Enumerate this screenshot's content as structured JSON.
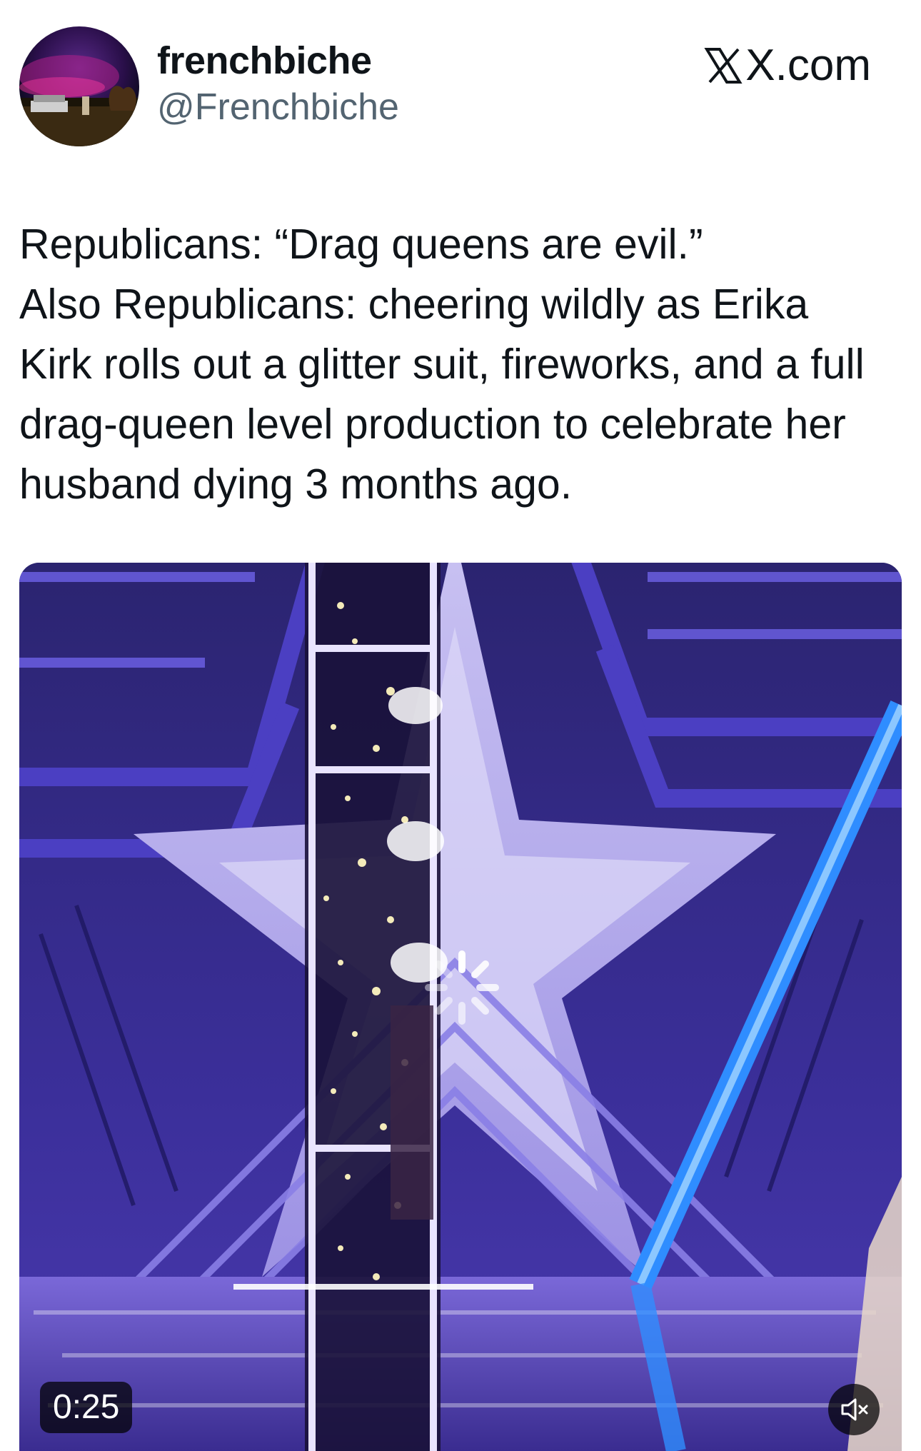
{
  "author": {
    "display_name": "frenchbiche",
    "handle": "@Frenchbiche",
    "avatar_icon": "profile-photo"
  },
  "brand": {
    "text": "X.com",
    "icon": "x-logo-icon"
  },
  "tweet": {
    "text": "Republicans: “Drag queens are evil.”\nAlso Republicans: cheering wildly as Erika Kirk rolls out a glitter suit, fireworks, and a full drag-queen level production to celebrate her husband dying 3 months ago."
  },
  "media": {
    "type": "video",
    "duration": "0:25",
    "loading_icon": "loading-spinner-icon",
    "mute_icon": "speaker-muted-icon"
  },
  "colors": {
    "text_primary": "#0f1419",
    "text_secondary": "#536471",
    "stage_purple": "#5b4bd0",
    "stage_blue_neon": "#2f8dff"
  }
}
